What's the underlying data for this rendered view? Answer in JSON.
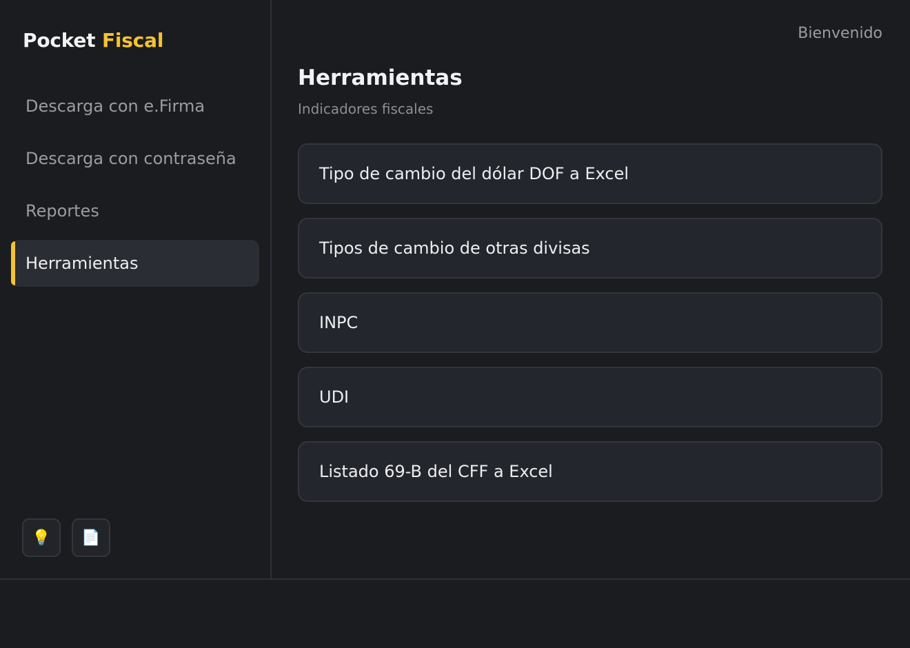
{
  "brand": {
    "name_part1": "Pocket",
    "name_part2": "Fiscal",
    "accent_color": "#f5c234"
  },
  "sidebar": {
    "items": [
      {
        "label": "Descarga con e.Firma",
        "active": false
      },
      {
        "label": "Descarga con contraseña",
        "active": false
      },
      {
        "label": "Reportes",
        "active": false
      },
      {
        "label": "Herramientas",
        "active": true
      }
    ],
    "bottom_buttons": [
      {
        "icon": "lightbulb-icon",
        "glyph": "💡"
      },
      {
        "icon": "document-icon",
        "glyph": "📄"
      }
    ]
  },
  "header": {
    "welcome": "Bienvenido"
  },
  "main": {
    "title": "Herramientas",
    "subtitle": "Indicadores fiscales",
    "tools": [
      {
        "label": "Tipo de cambio del dólar DOF a Excel"
      },
      {
        "label": "Tipos de cambio de otras divisas"
      },
      {
        "label": "INPC"
      },
      {
        "label": "UDI"
      },
      {
        "label": "Listado 69-B del CFF a Excel"
      }
    ]
  }
}
